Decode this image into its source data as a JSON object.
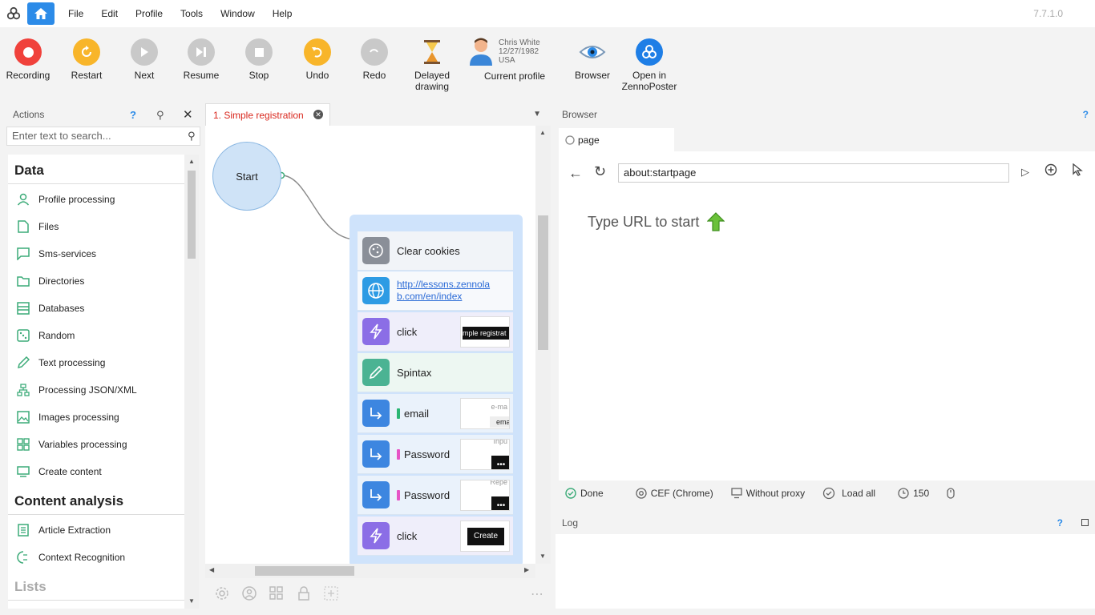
{
  "menu": {
    "items": [
      "File",
      "Edit",
      "Profile",
      "Tools",
      "Window",
      "Help"
    ],
    "version": "7.7.1.0"
  },
  "toolbar": {
    "recording": "Recording",
    "restart": "Restart",
    "next": "Next",
    "resume": "Resume",
    "stop": "Stop",
    "undo": "Undo",
    "redo": "Redo",
    "delayed_1": "Delayed",
    "delayed_2": "drawing",
    "profile_name": "Chris White",
    "profile_dob": "12/27/1982",
    "profile_country": "USA",
    "current_profile": "Current profile",
    "browser": "Browser",
    "open_1": "Open in",
    "open_2": "ZennoPoster"
  },
  "actions": {
    "title": "Actions",
    "help": "?",
    "search_placeholder": "Enter text to search...",
    "sections": [
      {
        "title": "Data",
        "items": [
          "Profile processing",
          "Files",
          "Sms-services",
          "Directories",
          "Databases",
          "Random",
          "Text processing",
          "Processing JSON/XML",
          "Images processing",
          "Variables processing",
          "Create content"
        ]
      },
      {
        "title": "Content analysis",
        "items": [
          "Article Extraction",
          "Context Recognition"
        ]
      },
      {
        "title": "Lists",
        "items": []
      }
    ]
  },
  "canvas": {
    "tab_title": "1. Simple registration",
    "start_label": "Start",
    "nodes": [
      {
        "label": "Clear cookies",
        "type": "cookies"
      },
      {
        "label": "http://lessons.zennolab.com/en/index",
        "type": "navigate",
        "line1": "http://lessons.zennola",
        "line2": "b.com/en/index"
      },
      {
        "label": "click",
        "type": "click",
        "thumb": "mple registrat"
      },
      {
        "label": "Spintax",
        "type": "spintax"
      },
      {
        "label": "email",
        "type": "set",
        "bar_color": "#2bb673",
        "thumb_top": "e-ma",
        "thumb_bottom": "ema"
      },
      {
        "label": "Password",
        "type": "set",
        "bar_color": "#e754c6",
        "thumb_top": "Inpu"
      },
      {
        "label": "Password",
        "type": "set",
        "bar_color": "#e754c6",
        "thumb_top": "Repe"
      },
      {
        "label": "click",
        "type": "click",
        "thumb": "Create"
      }
    ]
  },
  "browser": {
    "title": "Browser",
    "help": "?",
    "tab_label": "page",
    "address": "about:startpage",
    "hint": "Type URL to start",
    "status": {
      "done": "Done",
      "engine": "CEF (Chrome)",
      "proxy": "Without proxy",
      "load": "Load all",
      "timeout": "150"
    }
  },
  "log": {
    "title": "Log",
    "help": "?"
  },
  "colors": {
    "accent": "#2c8be8",
    "recording": "#f0413b",
    "restart": "#f8b52a",
    "disabled": "#c9c9c9",
    "tab_text": "#d9271d",
    "node_purple": "#8b6ee6",
    "node_green": "#4bb393",
    "node_blue": "#3d86e0"
  }
}
